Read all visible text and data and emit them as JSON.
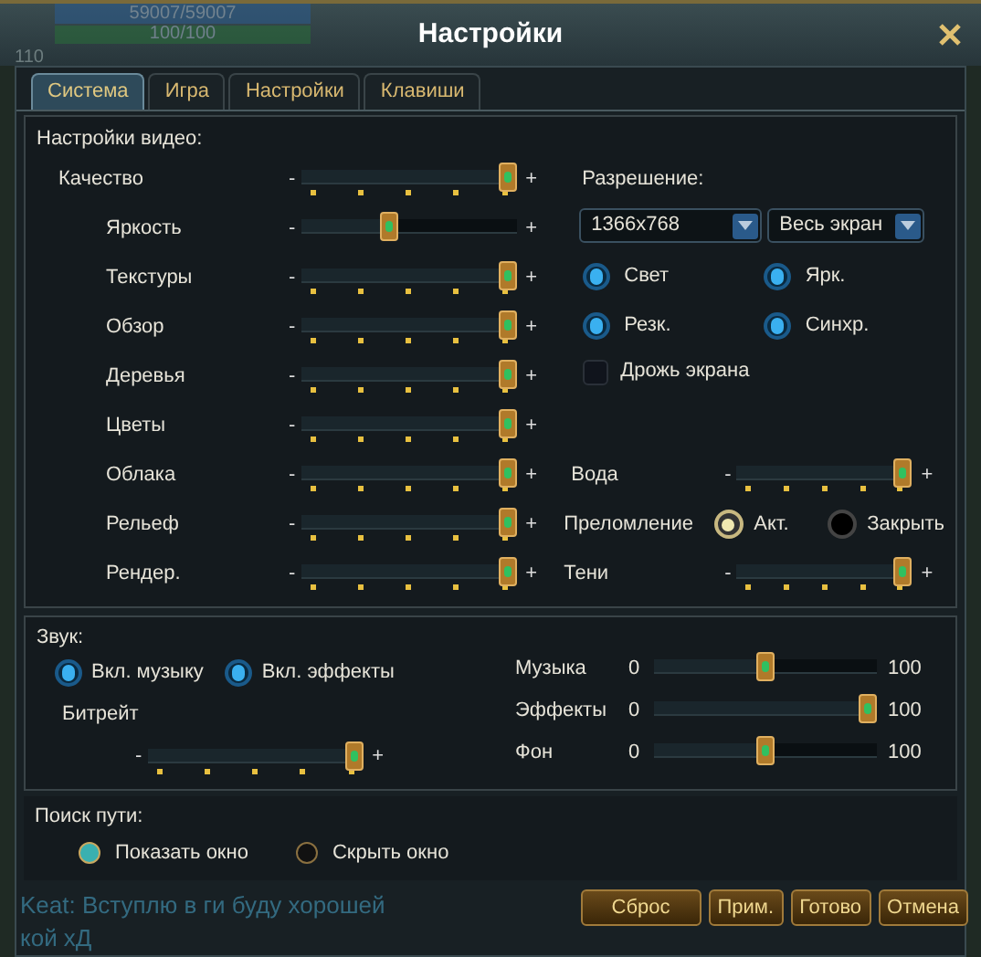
{
  "hud": {
    "hp": "59007/59007",
    "mp": "100/100",
    "level": "110"
  },
  "window": {
    "title": "Настройки"
  },
  "tabs": [
    {
      "label": "Система",
      "selected": true
    },
    {
      "label": "Игра",
      "selected": false
    },
    {
      "label": "Настройки",
      "selected": false
    },
    {
      "label": "Клавиши",
      "selected": false
    }
  ],
  "video": {
    "heading": "Настройки видео:",
    "sliders": [
      {
        "label": "Качество",
        "kind": "stepped",
        "minus": "-",
        "plus": "+",
        "level": 1
      },
      {
        "label": "Яркость",
        "kind": "smooth",
        "minus": "-",
        "plus": "+",
        "level": 0.4
      },
      {
        "label": "Текстуры",
        "kind": "stepped",
        "minus": "-",
        "plus": "+",
        "level": 1
      },
      {
        "label": "Обзор",
        "kind": "stepped",
        "minus": "-",
        "plus": "+",
        "level": 1
      },
      {
        "label": "Деревья",
        "kind": "stepped",
        "minus": "-",
        "plus": "+",
        "level": 1
      },
      {
        "label": "Цветы",
        "kind": "stepped",
        "minus": "-",
        "plus": "+",
        "level": 1
      },
      {
        "label": "Облака",
        "kind": "stepped",
        "minus": "-",
        "plus": "+",
        "level": 1
      },
      {
        "label": "Рельеф",
        "kind": "stepped",
        "minus": "-",
        "plus": "+",
        "level": 1
      },
      {
        "label": "Рендер.",
        "kind": "stepped",
        "minus": "-",
        "plus": "+",
        "level": 1
      }
    ],
    "resolution": {
      "label": "Разрешение:",
      "size": "1366x768",
      "mode": "Весь экран"
    },
    "toggles": [
      {
        "label": "Свет",
        "on": true
      },
      {
        "label": "Ярк.",
        "on": true
      },
      {
        "label": "Резк.",
        "on": true
      },
      {
        "label": "Синхр.",
        "on": true
      }
    ],
    "shake": {
      "label": "Дрожь экрана",
      "checked": false
    },
    "water": {
      "label": "Вода",
      "minus": "-",
      "plus": "+",
      "level": 1
    },
    "refraction": {
      "label": "Преломление",
      "options": [
        {
          "label": "Акт.",
          "selected": true
        },
        {
          "label": "Закрыть",
          "selected": false
        }
      ]
    },
    "shadows": {
      "label": "Тени",
      "minus": "-",
      "plus": "+",
      "level": 1
    }
  },
  "sound": {
    "heading": "Звук:",
    "toggles": [
      {
        "label": "Вкл. музыку",
        "on": true
      },
      {
        "label": "Вкл. эффекты",
        "on": true
      }
    ],
    "bitrate": {
      "label": "Битрейт",
      "minus": "-",
      "plus": "+",
      "level": 1
    },
    "volumes": [
      {
        "label": "Музыка",
        "min": "0",
        "max": "100",
        "level": 0.5
      },
      {
        "label": "Эффекты",
        "min": "0",
        "max": "100",
        "level": 1
      },
      {
        "label": "Фон",
        "min": "0",
        "max": "100",
        "level": 0.5
      }
    ]
  },
  "pathfinding": {
    "heading": "Поиск пути:",
    "options": [
      {
        "label": "Показать окно",
        "selected": true
      },
      {
        "label": "Скрыть окно",
        "selected": false
      }
    ]
  },
  "chat": [
    "Keat: Вступлю в ги буду хорошей",
    "кой хД"
  ],
  "buttons": [
    "Сброс",
    "Прим.",
    "Готово",
    "Отмена"
  ]
}
